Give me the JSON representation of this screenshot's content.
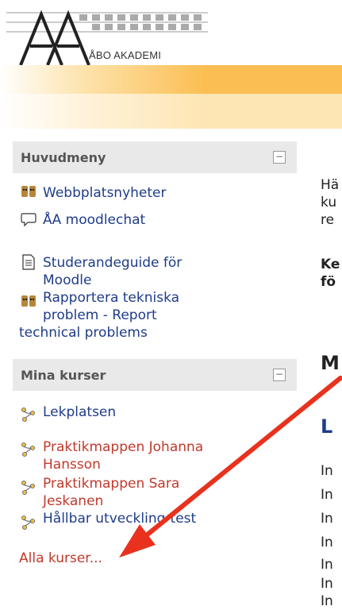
{
  "header": {
    "logo_text": "ÅBO AKADEMI"
  },
  "sidebar": {
    "blocks": [
      {
        "title": "Huvudmeny",
        "items": [
          {
            "label": "Webbplatsnyheter",
            "icon": "forum-icon"
          },
          {
            "label": "ÅA moodlechat",
            "icon": "chat-icon"
          },
          {
            "label_lines": [
              "Studerandeguide för",
              "Moodle"
            ],
            "icon": "document-icon"
          },
          {
            "label_lines": [
              "Rapportera tekniska",
              "problem - Report",
              "technical problems"
            ],
            "icon": "forum-icon"
          }
        ]
      },
      {
        "title": "Mina kurser",
        "items": [
          {
            "label": "Lekplatsen",
            "icon": "course-icon"
          },
          {
            "label_lines": [
              "Praktikmappen Johanna",
              "Hansson"
            ],
            "icon": "course-icon"
          },
          {
            "label_lines": [
              "Praktikmappen Sara",
              "Jeskanen"
            ],
            "icon": "course-icon"
          },
          {
            "label": "Hållbar utveckling-test",
            "icon": "course-icon"
          }
        ],
        "footer_link": "Alla kurser..."
      }
    ]
  },
  "main": {
    "intro_lines": [
      "Hä",
      "ku",
      "re"
    ],
    "bold_lines": [
      "Ke",
      "fö"
    ],
    "heading": "M",
    "course_heading": "L",
    "list_items": [
      "In",
      "In",
      "In",
      "In",
      "In",
      "In",
      "In"
    ]
  },
  "colors": {
    "link": "#1f3c8a",
    "course_red": "#c0392b",
    "arrow": "#e8321e",
    "band_orange": "#fbbe52"
  }
}
